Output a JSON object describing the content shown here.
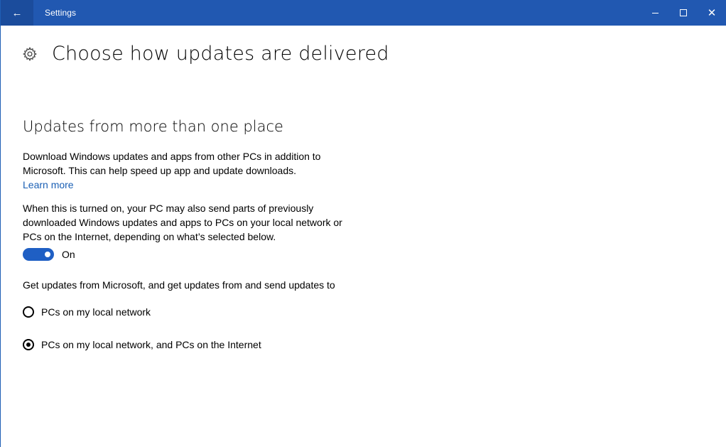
{
  "window": {
    "title": "Settings",
    "back_icon": "back-arrow-icon",
    "controls": [
      "minimize-icon",
      "maximize-icon",
      "close-icon"
    ]
  },
  "header": {
    "icon": "gear-icon",
    "title": "Choose how updates are delivered"
  },
  "section": {
    "title": "Updates from more than one place",
    "description": "Download Windows updates and apps from other PCs in addition to Microsoft. This can help speed up app and update downloads.",
    "learn_more": "Learn more",
    "toggle_description": "When this is turned on, your PC may also send parts of previously downloaded Windows updates and apps to PCs on your local network or PCs on the Internet, depending on what’s selected below.",
    "toggle": {
      "state": true,
      "label": "On"
    },
    "options_prompt": "Get updates from Microsoft, and get updates from and send updates to",
    "options": [
      {
        "label": "PCs on my local network",
        "selected": false
      },
      {
        "label": "PCs on my local network, and PCs on the Internet",
        "selected": true
      }
    ]
  },
  "colors": {
    "titlebar": "#2158b1",
    "accent": "#1f5fc4",
    "link": "#1a5fb4"
  }
}
